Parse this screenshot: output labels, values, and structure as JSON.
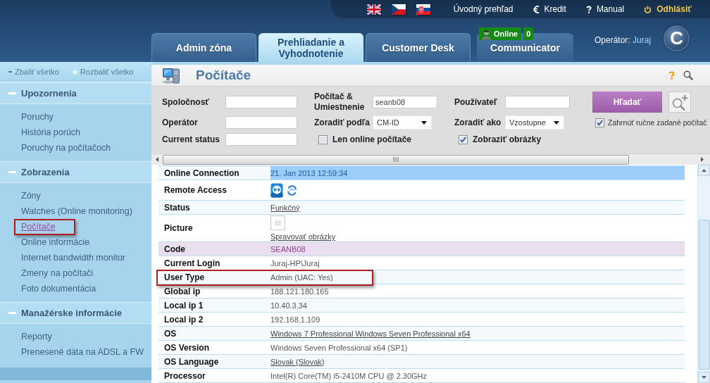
{
  "header": {
    "links": [
      {
        "kind": "home",
        "label": "Úvodný prehľad"
      },
      {
        "kind": "credit",
        "label": "Kredit"
      },
      {
        "kind": "help",
        "label": "Manual"
      },
      {
        "kind": "logout",
        "label": "Odhlásiť"
      }
    ],
    "tabs": [
      {
        "label": "Admin zóna",
        "selected": false
      },
      {
        "label": "Prehliadanie a Vyhodnotenie",
        "selected": true
      },
      {
        "label": "Customer Desk",
        "selected": false
      },
      {
        "label": "Communicator",
        "selected": false,
        "badge": {
          "status": "Online",
          "count": "0"
        }
      }
    ],
    "operator": {
      "label": "Operátor:",
      "name": "Juraj"
    },
    "logo": "C"
  },
  "sidebar": {
    "toolbar": [
      {
        "kind": "collapse",
        "label": "Zbaliť všetko"
      },
      {
        "kind": "expand",
        "label": "Rozbaliť všetko"
      }
    ],
    "sections": [
      {
        "title": "Upozornenia",
        "expanded": true,
        "items": [
          {
            "label": "Poruchy",
            "selected": false,
            "highlighted": false
          },
          {
            "label": "História porúch",
            "selected": false,
            "highlighted": false
          },
          {
            "label": "Poruchy na počítačoch",
            "selected": false,
            "highlighted": false
          }
        ]
      },
      {
        "title": "Zobrazenia",
        "expanded": true,
        "items": [
          {
            "label": "Zóny",
            "selected": false,
            "highlighted": false
          },
          {
            "label": "Watches (Online monitoring)",
            "selected": false,
            "highlighted": false
          },
          {
            "label": "Počítače",
            "selected": true,
            "highlighted": true
          },
          {
            "label": "Online informácie",
            "selected": false,
            "highlighted": false
          },
          {
            "label": "Internet bandwidth monitor",
            "selected": false,
            "highlighted": false
          },
          {
            "label": "Zmeny na počítači",
            "selected": false,
            "highlighted": false
          },
          {
            "label": "Foto dokumentácia",
            "selected": false,
            "highlighted": false
          }
        ]
      },
      {
        "title": "Manažérske informácie",
        "expanded": true,
        "items": [
          {
            "label": "Reporty",
            "selected": false,
            "highlighted": false
          },
          {
            "label": "Prenesené dáta na ADSL a FW",
            "selected": false,
            "highlighted": false
          }
        ]
      }
    ]
  },
  "page": {
    "title": "Počítače"
  },
  "filters": {
    "groups": [
      {
        "items": [
          {
            "kind": "input",
            "label": "Spoločnosť"
          },
          {
            "kind": "input",
            "label": "Operátor"
          },
          {
            "kind": "input",
            "label": "Current status"
          }
        ]
      },
      {
        "items": [
          {
            "kind": "input",
            "label": "Počítač & Umiestnenie",
            "value": "seanb08"
          },
          {
            "kind": "select",
            "label": "Zoradiť podľa",
            "value": "CM-ID"
          },
          {
            "kind": "checkbox",
            "label": "Len online počítače",
            "checked": false
          }
        ]
      },
      {
        "items": [
          {
            "kind": "input",
            "label": "Používateľ"
          },
          {
            "kind": "select",
            "label": "Zoradiť ako",
            "value": "Vzostupne"
          },
          {
            "kind": "checkbox",
            "label": "Zobraziť obrázky",
            "checked": true
          }
        ]
      }
    ],
    "search_button": "Hľadať",
    "options": [
      {
        "kind": "checkbox",
        "label": "Zahrnúť ručne zadané počítač",
        "checked": true
      }
    ]
  },
  "details": {
    "rows": [
      {
        "label": "Online Connection",
        "kind": "text",
        "value": "21. Jan 2013 12:59:34",
        "selected": true,
        "highlighted": false
      },
      {
        "label": "Remote Access",
        "kind": "icons",
        "selected": false,
        "highlighted": false
      },
      {
        "label": "Status",
        "kind": "link",
        "value": "Funkčný",
        "selected": false,
        "highlighted": false
      },
      {
        "label": "Picture",
        "kind": "picture",
        "value": "Spravovať obrázky",
        "selected": false,
        "highlighted": false
      },
      {
        "label": "Code",
        "kind": "code",
        "value": "SEANB08",
        "selected": false,
        "highlighted": false
      },
      {
        "label": "Current Login",
        "kind": "text",
        "value": "Juraj-HP\\Juraj",
        "selected": false,
        "highlighted": false
      },
      {
        "label": "User Type",
        "kind": "text",
        "value": "Admin (UAC: Yes)",
        "selected": false,
        "highlighted": true
      },
      {
        "label": "Global ip",
        "kind": "text",
        "value": "188.121.180.165",
        "selected": false,
        "highlighted": false
      },
      {
        "label": "Local ip 1",
        "kind": "text",
        "value": "10.40.3.34",
        "selected": false,
        "highlighted": false
      },
      {
        "label": "Local ip 2",
        "kind": "text",
        "value": "192.168.1.109",
        "selected": false,
        "highlighted": false
      },
      {
        "label": "OS",
        "kind": "link",
        "value": "Windows 7 Professional Windows Seven Professional x64",
        "selected": false,
        "highlighted": false
      },
      {
        "label": "OS Version",
        "kind": "text",
        "value": "Windows Seven Professional x64 (SP1)",
        "selected": false,
        "highlighted": false
      },
      {
        "label": "OS Language",
        "kind": "link",
        "value": "Slovak (Slovak)",
        "selected": false,
        "highlighted": false
      },
      {
        "label": "Processor",
        "kind": "text",
        "value": "Intel(R) Core(TM) i5-2410M CPU @ 2.30GHz",
        "selected": false,
        "highlighted": false
      }
    ]
  }
}
